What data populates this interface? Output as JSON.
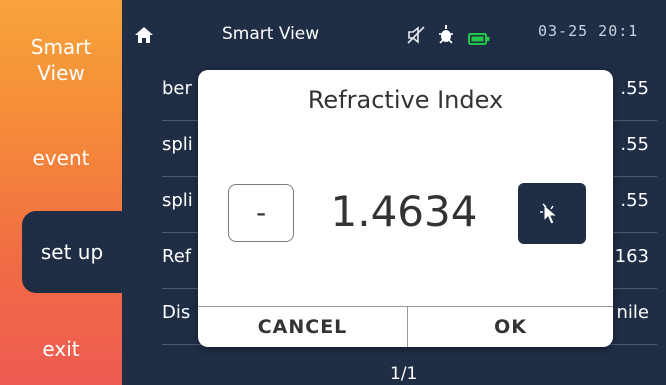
{
  "sidebar": {
    "items": [
      {
        "label": "Smart\nView"
      },
      {
        "label": "event"
      },
      {
        "label": "set up"
      },
      {
        "label": "exit"
      }
    ]
  },
  "statusbar": {
    "title": "Smart View",
    "time": "03-25 20:1",
    "icons": [
      "home-icon",
      "mute-icon",
      "probe-icon",
      "battery-icon"
    ],
    "battery_color": "#22c84a"
  },
  "settings": {
    "rows": [
      {
        "label": "ber",
        "value": ".55"
      },
      {
        "label": "spli",
        "value": ".55"
      },
      {
        "label": "spli",
        "value": ".55"
      },
      {
        "label": "Ref",
        "value": "163"
      },
      {
        "label": "Dis",
        "value": "nile"
      }
    ],
    "pager": "1/1"
  },
  "dialog": {
    "title": "Refractive Index",
    "minus_label": "-",
    "value": "1.4634",
    "cancel_label": "CANCEL",
    "ok_label": "OK"
  },
  "colors": {
    "background": "#1f2d45",
    "sidebar_top": "#f7a33a",
    "sidebar_bottom": "#ee5b52",
    "dialog": "#ffffff"
  }
}
